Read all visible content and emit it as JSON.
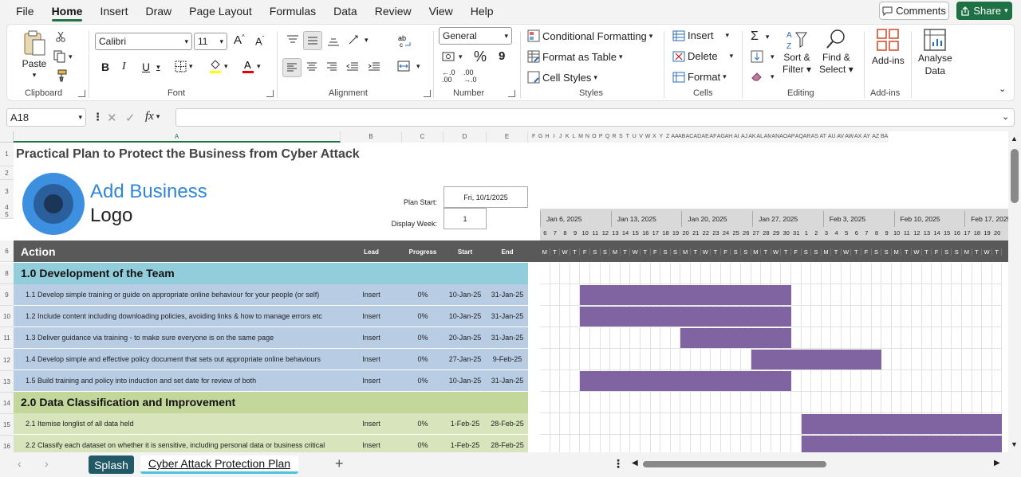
{
  "menu": [
    "File",
    "Home",
    "Insert",
    "Draw",
    "Page Layout",
    "Formulas",
    "Data",
    "Review",
    "View",
    "Help"
  ],
  "menu_active": "Home",
  "comments_label": "Comments",
  "share_label": "Share",
  "ribbon": {
    "clipboard": {
      "paste": "Paste",
      "label": "Clipboard"
    },
    "font": {
      "name": "Calibri",
      "size": "11",
      "label": "Font",
      "bold": "B",
      "italic": "I",
      "underline": "U"
    },
    "alignment": {
      "label": "Alignment"
    },
    "number": {
      "format": "General",
      "label": "Number",
      "percent": "%",
      "comma": "9",
      "inc": "←.0 .00",
      "dec": ".00 →.0"
    },
    "styles": {
      "conditional": "Conditional Formatting",
      "table": "Format as Table",
      "cell": "Cell Styles",
      "label": "Styles"
    },
    "cells": {
      "insert": "Insert",
      "delete": "Delete",
      "format": "Format",
      "label": "Cells"
    },
    "editing": {
      "sort": "Sort &",
      "sort2": "Filter",
      "find": "Find &",
      "find2": "Select",
      "label": "Editing"
    },
    "addins": {
      "btn": "Add-ins",
      "label": "Add-ins"
    },
    "analyse": {
      "line1": "Analyse",
      "line2": "Data"
    }
  },
  "namebox": "A18",
  "fx": "fx",
  "columns": {
    "main": [
      {
        "id": "A",
        "w": 410
      },
      {
        "id": "B",
        "w": 77
      },
      {
        "id": "C",
        "w": 52
      },
      {
        "id": "D",
        "w": 54
      },
      {
        "id": "E",
        "w": 52
      }
    ],
    "small": [
      "F",
      "G",
      "H",
      "I",
      "J",
      "K",
      "L",
      "M",
      "N",
      "O",
      "P",
      "Q",
      "R",
      "S",
      "T",
      "U",
      "V",
      "W",
      "X",
      "Y",
      "Z",
      "AA",
      "AB",
      "AC",
      "AD",
      "AE",
      "AF",
      "AG",
      "AH",
      "AI",
      "AJ",
      "AK",
      "AL",
      "AM",
      "AN",
      "AO",
      "AP",
      "AQ",
      "AR",
      "AS",
      "AT",
      "AU",
      "AV",
      "AW",
      "AX",
      "AY",
      "AZ",
      "BA"
    ]
  },
  "rows": [
    "1",
    "2",
    "3",
    "4",
    "5",
    "6",
    "8",
    "9",
    "10",
    "11",
    "12",
    "13",
    "14",
    "15",
    "16"
  ],
  "title": "Practical Plan to Protect the Business from Cyber Attack",
  "logo": {
    "line1": "Add Business",
    "line2": "Logo"
  },
  "plan_start_label": "Plan Start:",
  "plan_start": "Fri, 10/1/2025",
  "display_week_label": "Display Week:",
  "display_week": "1",
  "header": {
    "action": "Action",
    "lead": "Lead",
    "progress": "Progress",
    "start": "Start",
    "end": "End"
  },
  "weeks": [
    "Jan 6, 2025",
    "Jan 13, 2025",
    "Jan 20, 2025",
    "Jan 27, 2025",
    "Feb 3, 2025",
    "Feb 10, 2025",
    "Feb 17, 2025"
  ],
  "day_numbers": [
    "6",
    "7",
    "8",
    "9",
    "10",
    "11",
    "12",
    "13",
    "14",
    "15",
    "16",
    "17",
    "18",
    "19",
    "20",
    "21",
    "22",
    "23",
    "24",
    "25",
    "26",
    "27",
    "28",
    "29",
    "30",
    "31",
    "1",
    "2",
    "3",
    "4",
    "5",
    "6",
    "7",
    "8",
    "9",
    "10",
    "11",
    "12",
    "13",
    "14",
    "15",
    "16",
    "17",
    "18",
    "19",
    "20"
  ],
  "day_letters": [
    "M",
    "T",
    "W",
    "T",
    "F",
    "S",
    "S",
    "M",
    "T",
    "W",
    "T",
    "F",
    "S",
    "S",
    "M",
    "T",
    "W",
    "T",
    "F",
    "S",
    "S",
    "M",
    "T",
    "W",
    "T",
    "F",
    "S",
    "S",
    "M",
    "T",
    "W",
    "T",
    "F",
    "S",
    "S",
    "M",
    "T",
    "W",
    "T",
    "F",
    "S",
    "S",
    "M",
    "T",
    "W",
    "T"
  ],
  "sections": [
    {
      "title": "1.0 Development of the Team",
      "color": "#92cddc",
      "row_color": "#b8cce4",
      "tasks": [
        {
          "name": "1.1 Develop simple training or guide on appropriate online behaviour for your people (or self)",
          "lead": "Insert",
          "progress": "0%",
          "start": "10-Jan-25",
          "end": "31-Jan-25",
          "s": 4,
          "e": 25
        },
        {
          "name": "1.2  Include content including downloading policies, avoiding links & how to manage errors etc",
          "lead": "Insert",
          "progress": "0%",
          "start": "10-Jan-25",
          "end": "31-Jan-25",
          "s": 4,
          "e": 25
        },
        {
          "name": "1.3 Deliver guidance via training - to make sure everyone is on the same page",
          "lead": "Insert",
          "progress": "0%",
          "start": "20-Jan-25",
          "end": "31-Jan-25",
          "s": 14,
          "e": 25
        },
        {
          "name": "1.4 Develop simple and effective policy document that sets out appropriate online behaviours",
          "lead": "Insert",
          "progress": "0%",
          "start": "27-Jan-25",
          "end": "9-Feb-25",
          "s": 21,
          "e": 34
        },
        {
          "name": "1.5 Build training and policy into induction and set date for review of both",
          "lead": "Insert",
          "progress": "0%",
          "start": "10-Jan-25",
          "end": "31-Jan-25",
          "s": 4,
          "e": 25
        }
      ]
    },
    {
      "title": "2.0 Data Classification and Improvement",
      "color": "#c4d79b",
      "row_color": "#d8e4bc",
      "tasks": [
        {
          "name": "2.1 Itemise longlist of all data held",
          "lead": "Insert",
          "progress": "0%",
          "start": "1-Feb-25",
          "end": "28-Feb-25",
          "s": 26,
          "e": 46
        },
        {
          "name": "2.2 Classify each dataset on whether it is sensitive, including personal data or business critical",
          "lead": "Insert",
          "progress": "0%",
          "start": "1-Feb-25",
          "end": "28-Feb-25",
          "s": 26,
          "e": 46
        }
      ]
    }
  ],
  "bar_color": "#8064a2",
  "sheet_tabs": [
    "Splash",
    "Cyber Attack Protection Plan"
  ],
  "active_tab": "Cyber Attack Protection Plan"
}
